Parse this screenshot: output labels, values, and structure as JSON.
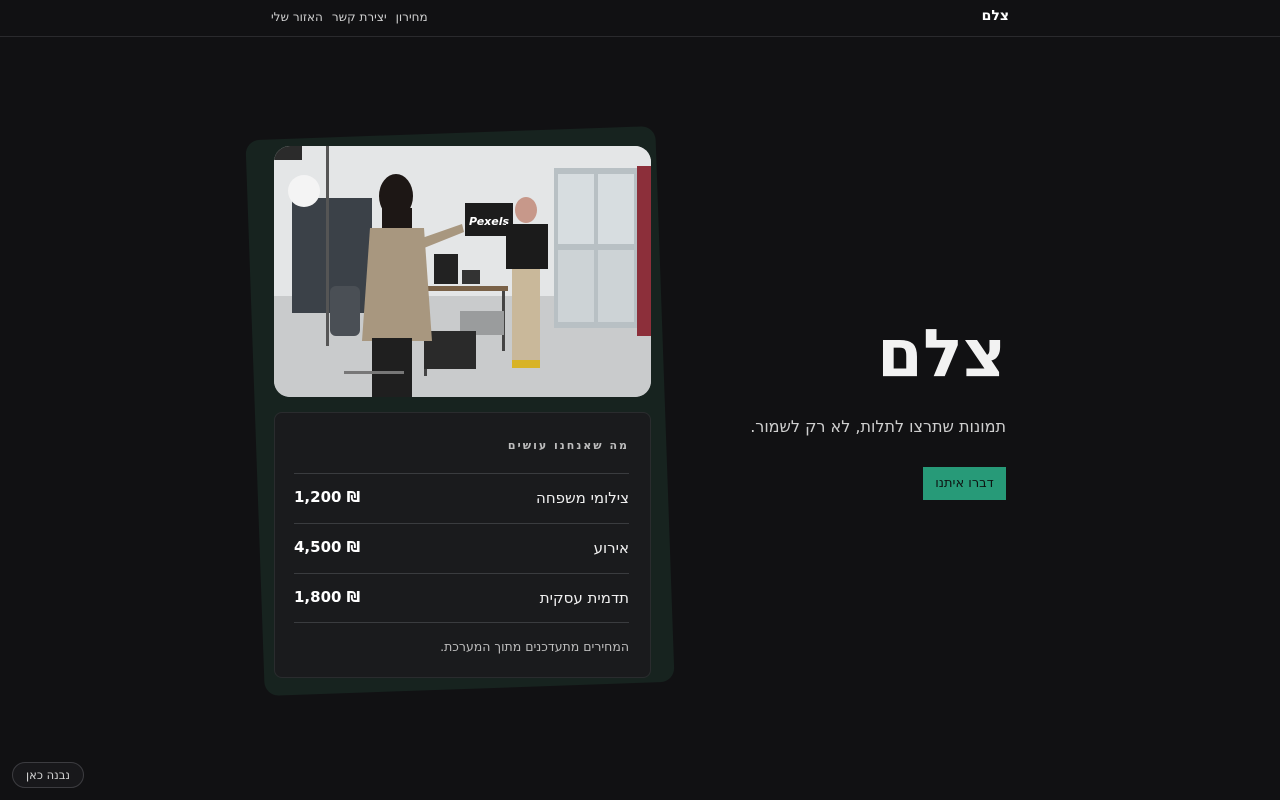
{
  "header": {
    "logo": "צלם",
    "nav": [
      {
        "label": "מחירון"
      },
      {
        "label": "יצירת קשר"
      },
      {
        "label": "האזור שלי"
      }
    ]
  },
  "hero": {
    "title": "צלם",
    "subtitle": "תמונות שתרצו לתלות, לא רק לשמור.",
    "cta_label": "דברו איתנו"
  },
  "photo": {
    "sign_text": "Pexels"
  },
  "pricing": {
    "heading": "מה שאנחנו עושים",
    "items": [
      {
        "name": "צילומי משפחה",
        "price": "₪ 1,200"
      },
      {
        "name": "אירוע",
        "price": "₪ 4,500"
      },
      {
        "name": "תדמית עסקית",
        "price": "₪ 1,800"
      }
    ],
    "note": "המחירים מתעדכנים מתוך המערכת."
  },
  "badge": {
    "label": "נבנה כאן"
  },
  "colors": {
    "background": "#111113",
    "accent": "#279a78",
    "card_back": "#17231f"
  }
}
